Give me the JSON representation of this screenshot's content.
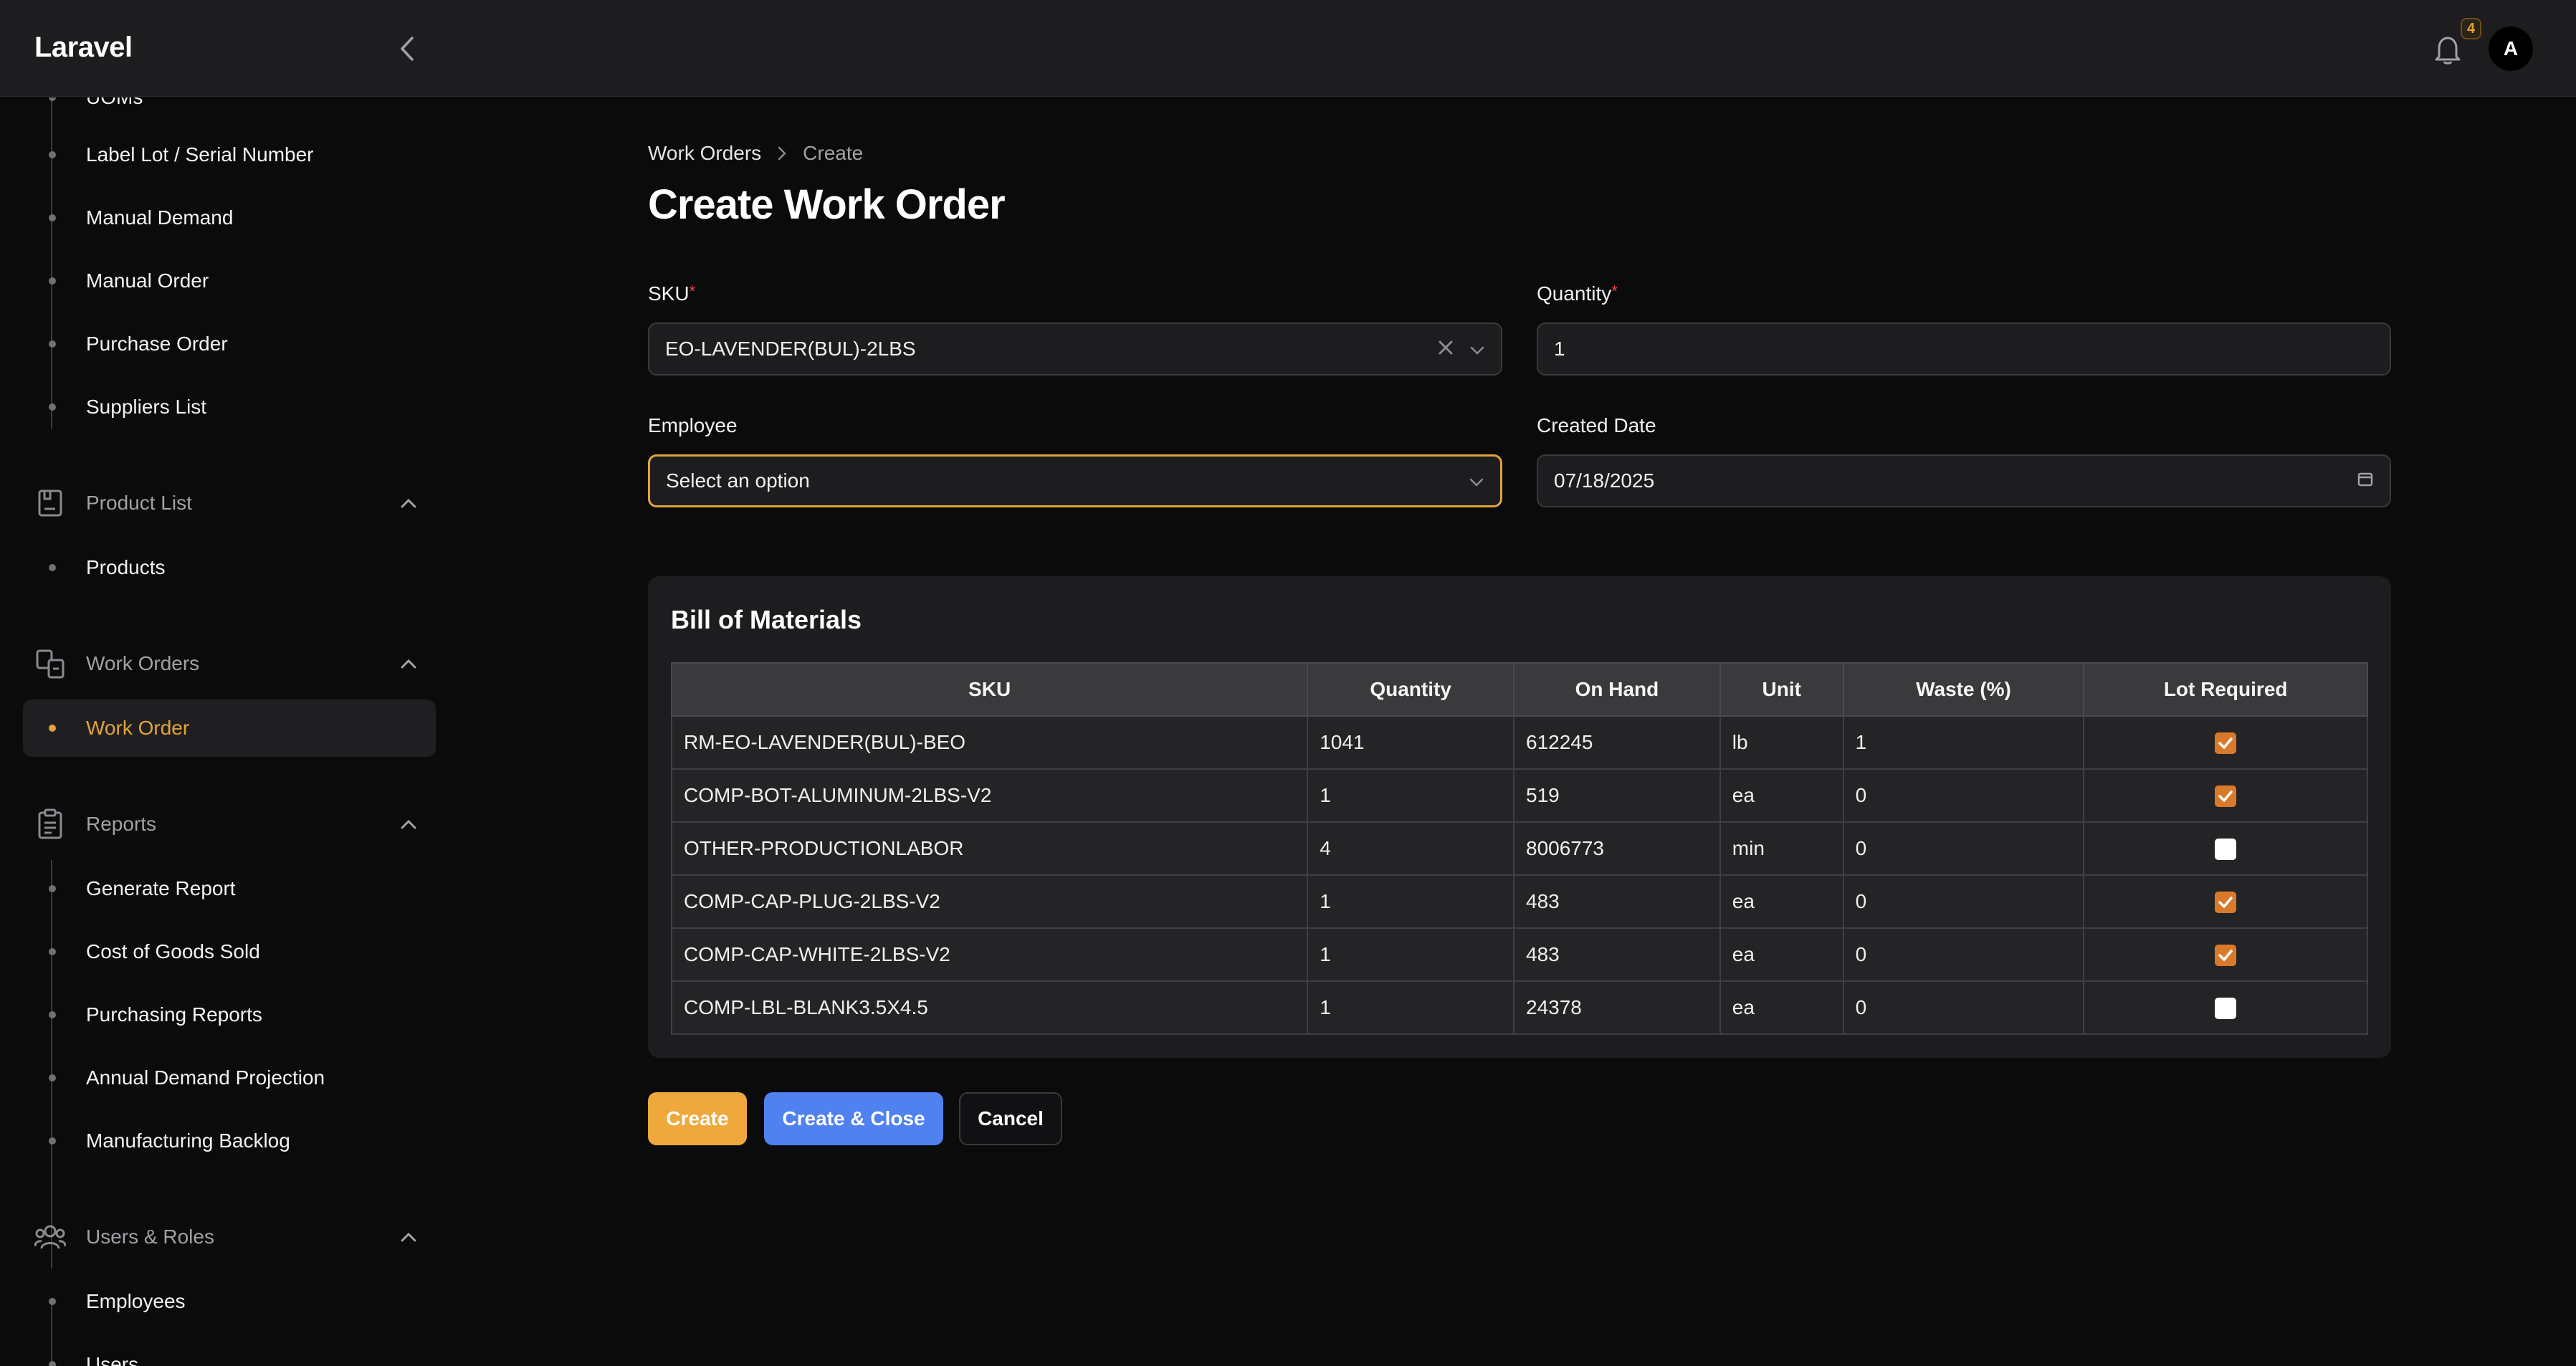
{
  "app": {
    "brand": "Laravel"
  },
  "header": {
    "notification_count": "4",
    "avatar_initial": "A"
  },
  "sidebar": {
    "partial_top_item": "UOMs",
    "items_purchasing": [
      "Label Lot / Serial Number",
      "Manual Demand",
      "Manual Order",
      "Purchase Order",
      "Suppliers List"
    ],
    "groups": {
      "product_list": {
        "label": "Product List",
        "items": [
          "Products"
        ]
      },
      "work_orders": {
        "label": "Work Orders",
        "items": [
          "Work Order"
        ],
        "active": "Work Order"
      },
      "reports": {
        "label": "Reports",
        "items": [
          "Generate Report",
          "Cost of Goods Sold",
          "Purchasing Reports",
          "Annual Demand Projection",
          "Manufacturing Backlog"
        ]
      },
      "users_roles": {
        "label": "Users & Roles",
        "items": [
          "Employees",
          "Users"
        ]
      }
    }
  },
  "breadcrumb": {
    "parent": "Work Orders",
    "current": "Create"
  },
  "page": {
    "title": "Create Work Order"
  },
  "form": {
    "sku": {
      "label": "SKU",
      "value": "EO-LAVENDER(BUL)-2LBS"
    },
    "quantity": {
      "label": "Quantity",
      "value": "1"
    },
    "employee": {
      "label": "Employee",
      "placeholder": "Select an option"
    },
    "created_date": {
      "label": "Created Date",
      "value": "07/18/2025"
    }
  },
  "bom": {
    "title": "Bill of Materials",
    "columns": [
      "SKU",
      "Quantity",
      "On Hand",
      "Unit",
      "Waste (%)",
      "Lot Required"
    ],
    "rows": [
      {
        "sku": "RM-EO-LAVENDER(BUL)-BEO",
        "quantity": "1041",
        "on_hand": "612245",
        "unit": "lb",
        "waste": "1",
        "lot_required": true
      },
      {
        "sku": "COMP-BOT-ALUMINUM-2LBS-V2",
        "quantity": "1",
        "on_hand": "519",
        "unit": "ea",
        "waste": "0",
        "lot_required": true
      },
      {
        "sku": "OTHER-PRODUCTIONLABOR",
        "quantity": "4",
        "on_hand": "8006773",
        "unit": "min",
        "waste": "0",
        "lot_required": false
      },
      {
        "sku": "COMP-CAP-PLUG-2LBS-V2",
        "quantity": "1",
        "on_hand": "483",
        "unit": "ea",
        "waste": "0",
        "lot_required": true
      },
      {
        "sku": "COMP-CAP-WHITE-2LBS-V2",
        "quantity": "1",
        "on_hand": "483",
        "unit": "ea",
        "waste": "0",
        "lot_required": true
      },
      {
        "sku": "COMP-LBL-BLANK3.5X4.5",
        "quantity": "1",
        "on_hand": "24378",
        "unit": "ea",
        "waste": "0",
        "lot_required": false
      }
    ]
  },
  "actions": {
    "create": "Create",
    "create_close": "Create & Close",
    "cancel": "Cancel"
  },
  "colors": {
    "accent": "#e3a33a",
    "primary_button": "#efa83c",
    "secondary_button": "#4f81f0",
    "checkbox_on": "#d97a2b"
  },
  "icons": {
    "collapse": "chevron-left-icon",
    "notifications": "bell-icon",
    "product_list": "archive-icon",
    "work_orders": "swap-icon",
    "reports": "clipboard-icon",
    "users_roles": "users-icon",
    "group_toggle": "chevron-up-icon",
    "clear": "x-icon",
    "select": "chevron-down-icon",
    "calendar": "calendar-icon"
  }
}
